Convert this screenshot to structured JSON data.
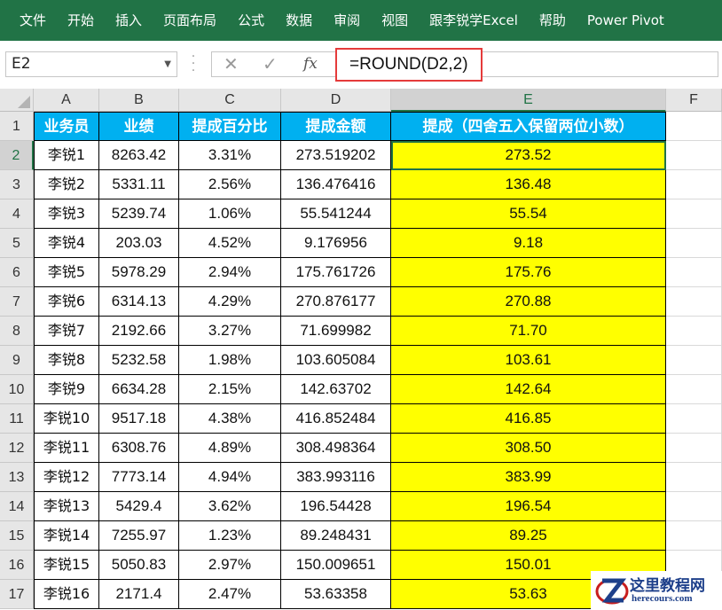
{
  "ribbon": {
    "tabs": [
      "文件",
      "开始",
      "插入",
      "页面布局",
      "公式",
      "数据",
      "审阅",
      "视图",
      "跟李锐学Excel",
      "帮助",
      "Power Pivot"
    ]
  },
  "formula_bar": {
    "name_box": "E2",
    "cancel_glyph": "✕",
    "enter_glyph": "✓",
    "fx_label": "fx",
    "formula": "=ROUND(D2,2)"
  },
  "columns": [
    "A",
    "B",
    "C",
    "D",
    "E",
    "F"
  ],
  "selected_column": "E",
  "selected_row": 2,
  "row_numbers": [
    1,
    2,
    3,
    4,
    5,
    6,
    7,
    8,
    9,
    10,
    11,
    12,
    13,
    14,
    15,
    16,
    17
  ],
  "table": {
    "headers": [
      "业务员",
      "业绩",
      "提成百分比",
      "提成金额",
      "提成（四舍五入保留两位小数）"
    ],
    "rows": [
      [
        "李锐1",
        "8263.42",
        "3.31%",
        "273.519202",
        "273.52"
      ],
      [
        "李锐2",
        "5331.11",
        "2.56%",
        "136.476416",
        "136.48"
      ],
      [
        "李锐3",
        "5239.74",
        "1.06%",
        "55.541244",
        "55.54"
      ],
      [
        "李锐4",
        "203.03",
        "4.52%",
        "9.176956",
        "9.18"
      ],
      [
        "李锐5",
        "5978.29",
        "2.94%",
        "175.761726",
        "175.76"
      ],
      [
        "李锐6",
        "6314.13",
        "4.29%",
        "270.876177",
        "270.88"
      ],
      [
        "李锐7",
        "2192.66",
        "3.27%",
        "71.699982",
        "71.70"
      ],
      [
        "李锐8",
        "5232.58",
        "1.98%",
        "103.605084",
        "103.61"
      ],
      [
        "李锐9",
        "6634.28",
        "2.15%",
        "142.63702",
        "142.64"
      ],
      [
        "李锐10",
        "9517.18",
        "4.38%",
        "416.852484",
        "416.85"
      ],
      [
        "李锐11",
        "6308.76",
        "4.89%",
        "308.498364",
        "308.50"
      ],
      [
        "李锐12",
        "7773.14",
        "4.94%",
        "383.993116",
        "383.99"
      ],
      [
        "李锐13",
        "5429.4",
        "3.62%",
        "196.54428",
        "196.54"
      ],
      [
        "李锐14",
        "7255.97",
        "1.23%",
        "89.248431",
        "89.25"
      ],
      [
        "李锐15",
        "5050.83",
        "2.97%",
        "150.009651",
        "150.01"
      ],
      [
        "李锐16",
        "2171.4",
        "2.47%",
        "53.63358",
        "53.63"
      ]
    ]
  },
  "colors": {
    "ribbon": "#217346",
    "header_fill": "#00b0f0",
    "highlight_fill": "#ffff00",
    "formula_outline": "#e53b3b"
  },
  "watermark": {
    "title": "这里教程网",
    "subtitle": "herecours.com"
  }
}
